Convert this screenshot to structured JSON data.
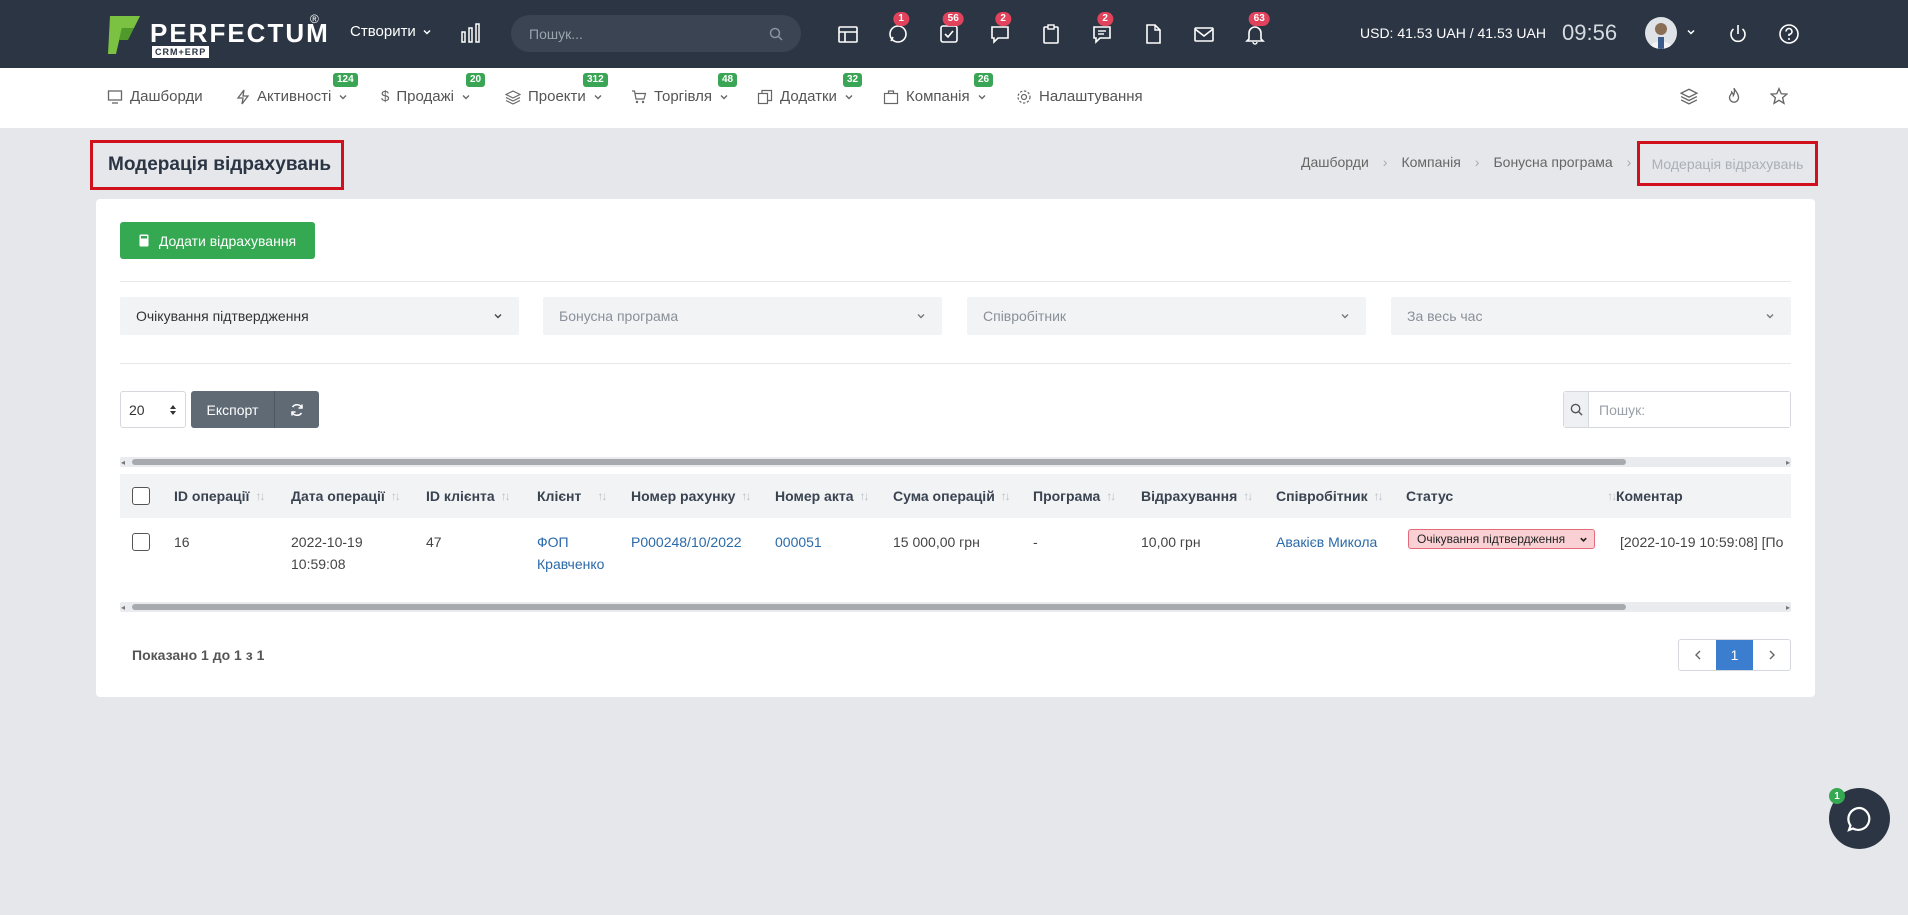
{
  "app": {
    "logo_text": "PERFECTUM",
    "logo_sub": "CRM+ERP",
    "logo_reg": "®",
    "brand_color": "#2b3543",
    "accent_green": "#35a852"
  },
  "topbar": {
    "create_label": "Створити",
    "search_placeholder": "Пошук...",
    "icons": [
      {
        "name": "cashbox-icon",
        "badge": ""
      },
      {
        "name": "chat-icon",
        "badge": "1"
      },
      {
        "name": "tasks-icon",
        "badge": "56"
      },
      {
        "name": "messages-icon",
        "badge": "2"
      },
      {
        "name": "clipboard-icon",
        "badge": ""
      },
      {
        "name": "comments-icon",
        "badge": "2"
      },
      {
        "name": "document-icon",
        "badge": ""
      },
      {
        "name": "mail-icon",
        "badge": ""
      },
      {
        "name": "bell-icon",
        "badge": "63"
      }
    ],
    "currency": "USD: 41.53 UAH / 41.53 UAH",
    "time": "09:56"
  },
  "nav": {
    "items": [
      {
        "label": "Дашборди",
        "badge": ""
      },
      {
        "label": "Активності",
        "badge": "124"
      },
      {
        "label": "Продажі",
        "badge": "20"
      },
      {
        "label": "Проекти",
        "badge": "312"
      },
      {
        "label": "Торгівля",
        "badge": "48"
      },
      {
        "label": "Додатки",
        "badge": "32"
      },
      {
        "label": "Компанія",
        "badge": "26"
      },
      {
        "label": "Налаштування",
        "badge": ""
      }
    ]
  },
  "page": {
    "title": "Модерація відрахувань",
    "breadcrumb": [
      "Дашборди",
      "Компанія",
      "Бонусна програма",
      "Модерація відрахувань"
    ]
  },
  "toolbar": {
    "add_label": "Додати відрахування",
    "filters": {
      "status": "Очікування підтвердження",
      "program_placeholder": "Бонусна програма",
      "employee_placeholder": "Співробітник",
      "period_placeholder": "За весь час"
    },
    "page_size": "20",
    "export_label": "Експорт",
    "search_placeholder": "Пошук:"
  },
  "table": {
    "columns": [
      "ID операції",
      "Дата операції",
      "ID клієнта",
      "Клієнт",
      "Номер рахунку",
      "Номер акта",
      "Сума операцій",
      "Програма",
      "Відрахування",
      "Співробітник",
      "Статус",
      "Коментар"
    ],
    "rows": [
      {
        "id": "16",
        "date": "2022-10-19",
        "time": "10:59:08",
        "client_id": "47",
        "client_line1": "ФОП",
        "client_line2": "Кравченко",
        "invoice": "P000248/10/2022",
        "act": "000051",
        "sum": "15 000,00 грн",
        "program": "-",
        "deduction": "10,00 грн",
        "employee": "Авакієв Микола",
        "status": "Очікування підтвердження",
        "comment": "[2022-10-19 10:59:08] [По"
      }
    ]
  },
  "footer": {
    "shown": "Показано 1 до 1 з 1",
    "current_page": "1"
  },
  "chat": {
    "badge": "1"
  }
}
